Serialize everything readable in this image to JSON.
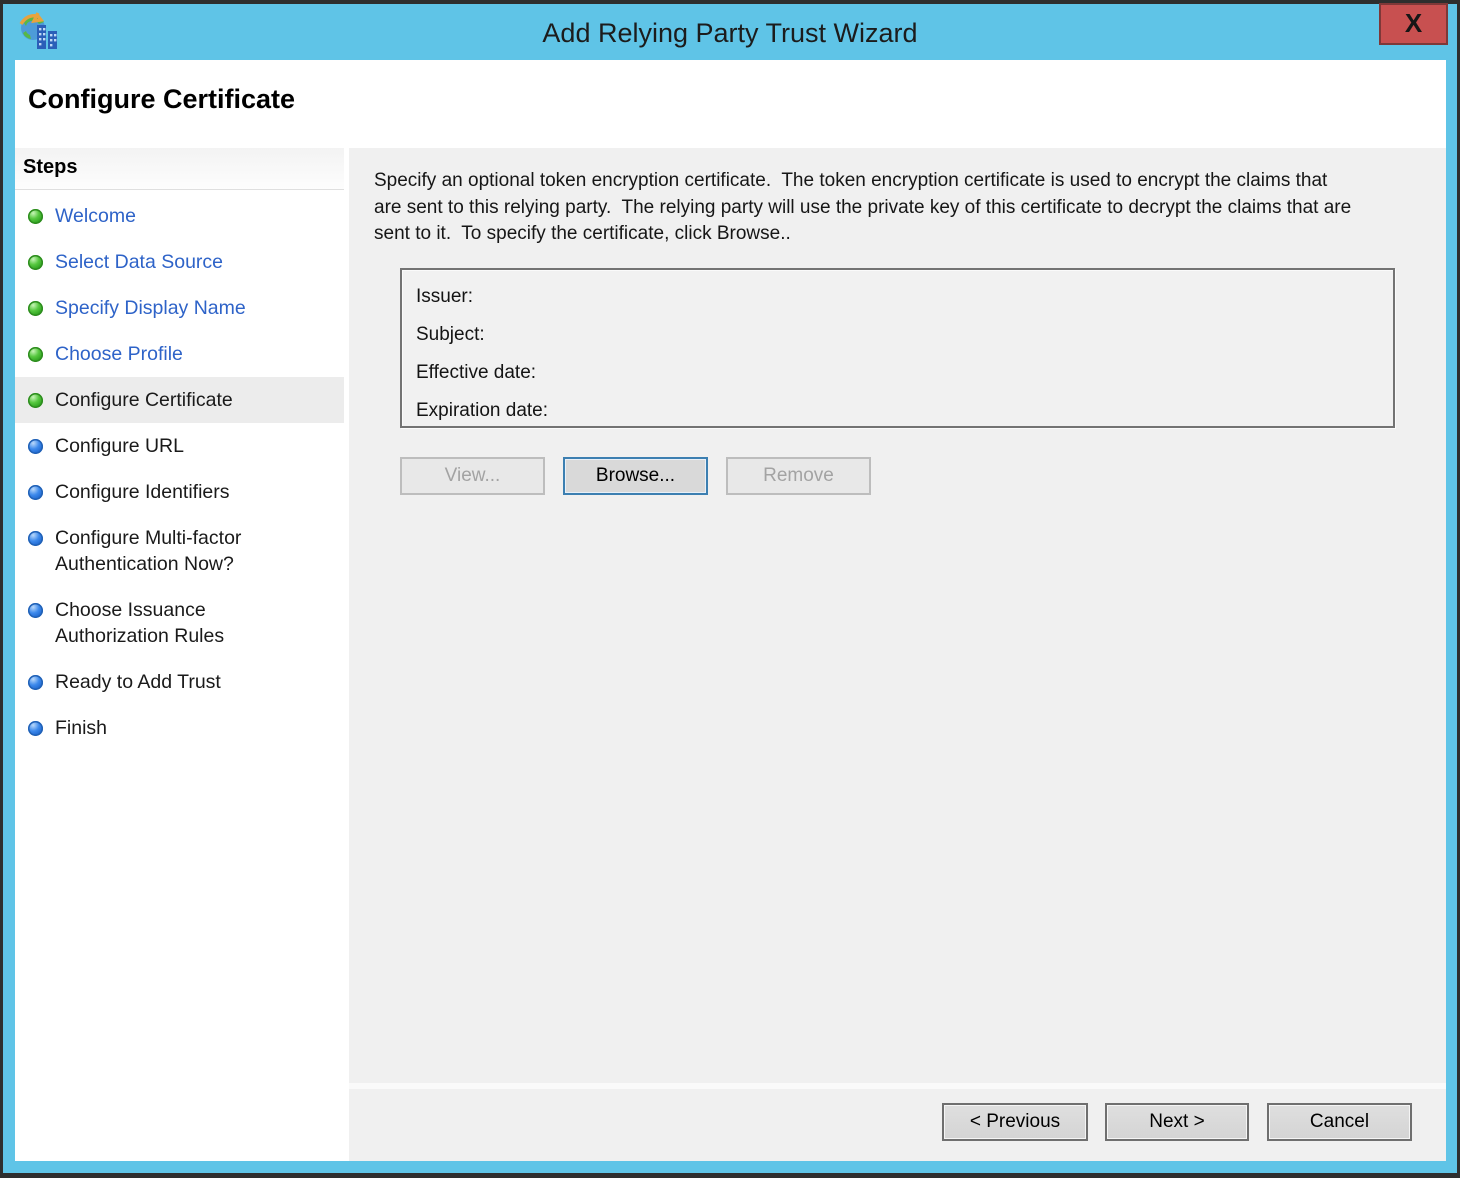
{
  "window": {
    "title": "Add Relying Party Trust Wizard",
    "close_glyph": "X",
    "page_title": "Configure Certificate"
  },
  "colors": {
    "titlebar_blue": "#5FC4E7",
    "close_red": "#C85050",
    "link_blue": "#2E63C8",
    "bullet_green": "#2FA320",
    "bullet_blue": "#1F68D0",
    "panel_gray": "#F0F0F0"
  },
  "sidebar": {
    "heading": "Steps",
    "items": [
      {
        "label": "Welcome",
        "state": "done"
      },
      {
        "label": "Select Data Source",
        "state": "done"
      },
      {
        "label": "Specify Display Name",
        "state": "done"
      },
      {
        "label": "Choose Profile",
        "state": "done"
      },
      {
        "label": "Configure Certificate",
        "state": "current"
      },
      {
        "label": "Configure URL",
        "state": "upcoming"
      },
      {
        "label": "Configure Identifiers",
        "state": "upcoming"
      },
      {
        "label": "Configure Multi-factor Authentication Now?",
        "state": "upcoming"
      },
      {
        "label": "Choose Issuance Authorization Rules",
        "state": "upcoming"
      },
      {
        "label": "Ready to Add Trust",
        "state": "upcoming"
      },
      {
        "label": "Finish",
        "state": "upcoming"
      }
    ]
  },
  "content": {
    "instructions": "Specify an optional token encryption certificate.  The token encryption certificate is used to encrypt the claims that are sent to this relying party.  The relying party will use the private key of this certificate to decrypt the claims that are sent to it.  To specify the certificate, click Browse..",
    "certificate_fields": [
      "Issuer:",
      "Subject:",
      "Effective date:",
      "Expiration date:"
    ],
    "actions": {
      "view": "View...",
      "browse": "Browse...",
      "remove": "Remove"
    }
  },
  "footer": {
    "previous": "< Previous",
    "next": "Next >",
    "cancel": "Cancel"
  }
}
